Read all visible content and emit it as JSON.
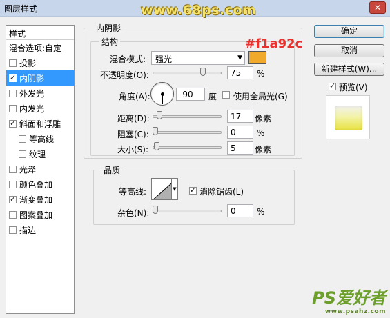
{
  "window": {
    "title": "图层样式",
    "close_glyph": "✕",
    "watermark": "www.68ps.com"
  },
  "left_panel": {
    "header": "样式",
    "blend_options": "混合选项:自定",
    "items": [
      {
        "label": "投影",
        "checked": false,
        "active": false,
        "sub": false
      },
      {
        "label": "内阴影",
        "checked": true,
        "active": true,
        "sub": false
      },
      {
        "label": "外发光",
        "checked": false,
        "active": false,
        "sub": false
      },
      {
        "label": "内发光",
        "checked": false,
        "active": false,
        "sub": false
      },
      {
        "label": "斜面和浮雕",
        "checked": true,
        "active": false,
        "sub": false
      },
      {
        "label": "等高线",
        "checked": false,
        "active": false,
        "sub": true
      },
      {
        "label": "纹理",
        "checked": false,
        "active": false,
        "sub": true
      },
      {
        "label": "光泽",
        "checked": false,
        "active": false,
        "sub": false
      },
      {
        "label": "颜色叠加",
        "checked": false,
        "active": false,
        "sub": false
      },
      {
        "label": "渐变叠加",
        "checked": true,
        "active": false,
        "sub": false
      },
      {
        "label": "图案叠加",
        "checked": false,
        "active": false,
        "sub": false
      },
      {
        "label": "描边",
        "checked": false,
        "active": false,
        "sub": false
      }
    ]
  },
  "inner_shadow": {
    "section_title": "内阴影",
    "structure": {
      "title": "结构",
      "blend_mode_label": "混合模式:",
      "blend_mode_value": "强光",
      "color_hex": "#f1a92c",
      "color_annotation": "#f1a92c",
      "opacity_label": "不透明度(O):",
      "opacity_value": "75",
      "opacity_unit": "%",
      "opacity_fraction": 0.75,
      "angle_label": "角度(A):",
      "angle_value": "-90",
      "angle_unit": "度",
      "global_light_label": "使用全局光(G)",
      "global_light_checked": false,
      "distance_label": "距离(D):",
      "distance_value": "17",
      "distance_unit": "像素",
      "distance_fraction": 0.07,
      "choke_label": "阻塞(C):",
      "choke_value": "0",
      "choke_unit": "%",
      "choke_fraction": 0.0,
      "size_label": "大小(S):",
      "size_value": "5",
      "size_unit": "像素",
      "size_fraction": 0.02
    },
    "quality": {
      "title": "品质",
      "contour_label": "等高线:",
      "antialias_label": "消除锯齿(L)",
      "antialias_checked": true,
      "noise_label": "杂色(N):",
      "noise_value": "0",
      "noise_unit": "%",
      "noise_fraction": 0.0
    }
  },
  "buttons": {
    "ok": "确定",
    "cancel": "取消",
    "new_style": "新建样式(W)...",
    "preview_label": "预览(V)",
    "preview_checked": true
  },
  "logo": {
    "main": "PS爱好者",
    "sub": "www.psahz.com"
  }
}
